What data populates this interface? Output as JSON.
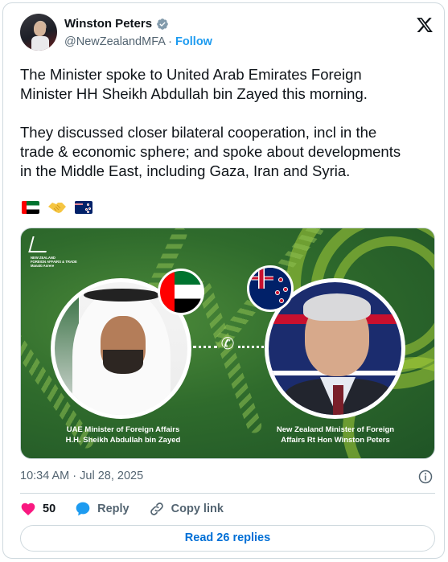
{
  "author": {
    "name": "Winston Peters",
    "handle": "@NewZealandMFA",
    "separator": "·",
    "follow_label": "Follow",
    "verified_icon": "verified-badge-icon"
  },
  "platform_logo": "x-logo-icon",
  "tweet": {
    "paragraph1": "The Minister spoke to United Arab Emirates Foreign\nMinister HH Sheikh Abdullah bin Zayed this morning.",
    "paragraph2": "They discussed closer bilateral cooperation, incl in the\ntrade & economic sphere; and spoke about developments\nin the Middle East, including Gaza, Iran and Syria.",
    "emojis": [
      "flag-uae",
      "handshake",
      "flag-new-zealand"
    ]
  },
  "media": {
    "logo_text": [
      "NEW ZEALAND",
      "FOREIGN AFFAIRS & TRADE",
      "Manatū Aorere"
    ],
    "left_caption": "UAE Minister of Foreign Affairs\nH.H. Sheikh Abdullah bin Zayed",
    "right_caption": "New Zealand Minister of Foreign\nAffairs Rt Hon Winston Peters",
    "colors": {
      "background": "#2f6b2c",
      "accent_arc": "#a6ce39"
    }
  },
  "meta": {
    "time": "10:34 AM",
    "separator": "·",
    "date": "Jul 28, 2025"
  },
  "actions": {
    "like_count": "50",
    "reply_label": "Reply",
    "copy_link_label": "Copy link"
  },
  "read_replies_label": "Read 26 replies",
  "colors": {
    "link_blue": "#1d9bf0",
    "like_pink": "#f91880",
    "reply_blue": "#1d9bf0",
    "border": "#cfd9de",
    "secondary_text": "#536471"
  }
}
